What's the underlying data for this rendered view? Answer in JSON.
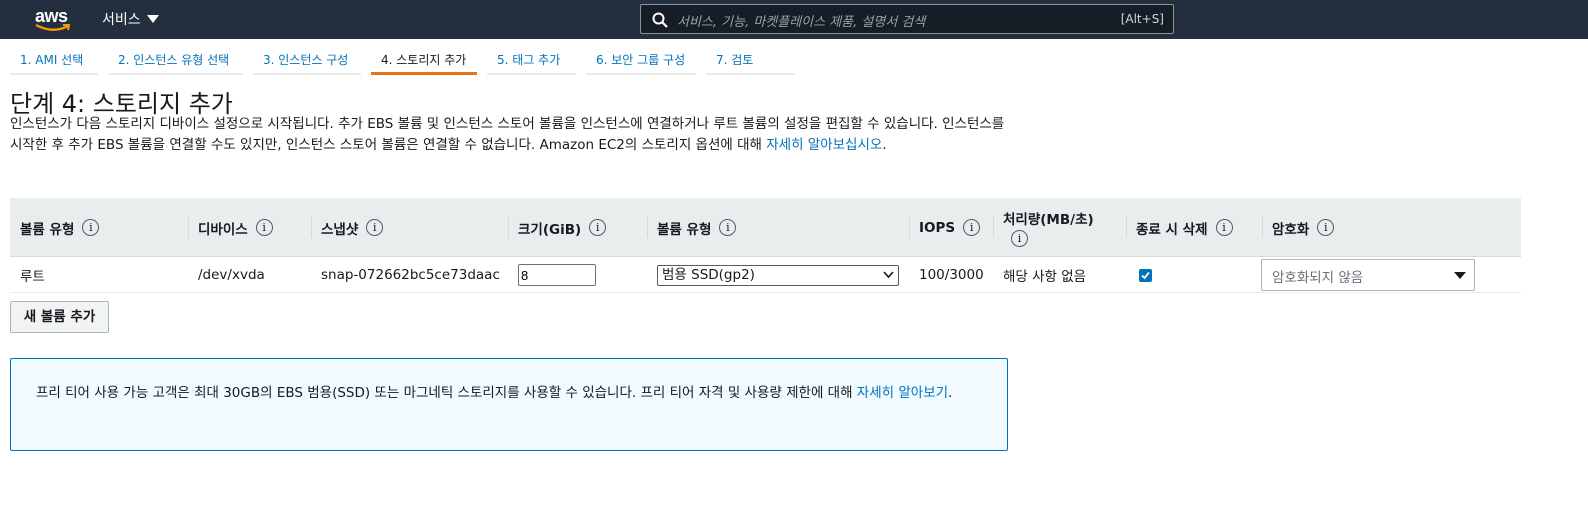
{
  "nav": {
    "logo_text": "aws",
    "services_label": "서비스",
    "search_placeholder": "서비스, 기능, 마켓플레이스 제품, 설명서 검색",
    "search_shortcut": "[Alt+S]"
  },
  "tabs": [
    {
      "label": "1. AMI 선택",
      "active": false
    },
    {
      "label": "2. 인스턴스 유형 선택",
      "active": false
    },
    {
      "label": "3. 인스턴스 구성",
      "active": false
    },
    {
      "label": "4. 스토리지 추가",
      "active": true
    },
    {
      "label": "5. 태그 추가",
      "active": false
    },
    {
      "label": "6. 보안 그룹 구성",
      "active": false
    },
    {
      "label": "7. 검토",
      "active": false
    }
  ],
  "page": {
    "title": "단계 4: 스토리지 추가",
    "description": "인스턴스가 다음 스토리지 디바이스 설정으로 시작됩니다. 추가 EBS 볼륨 및 인스턴스 스토어 볼륨을 인스턴스에 연결하거나 루트 볼륨의 설정을 편집할 수 있습니다. 인스턴스를 시작한 후 추가 EBS 볼륨을 연결할 수도 있지만, 인스턴스 스토어 볼륨은 연결할 수 없습니다. Amazon EC2의 스토리지 옵션에 대해 ",
    "learn_more": "자세히 알아보십시오",
    "period": "."
  },
  "table": {
    "headers": {
      "volume_type": "볼륨 유형",
      "device": "디바이스",
      "snapshot": "스냅샷",
      "size": "크기(GiB)",
      "ebs_type": "볼륨 유형",
      "iops": "IOPS",
      "throughput": "처리량(MB/초)",
      "delete_on_term": "종료 시 삭제",
      "encryption": "암호화"
    },
    "info_glyph": "i",
    "row": {
      "volume_type": "루트",
      "device": "/dev/xvda",
      "snapshot": "snap-072662bc5ce73daac",
      "size": "8",
      "ebs_type": "범용 SSD(gp2)",
      "iops": "100/3000",
      "throughput": "해당 사항 없음",
      "delete_on_termination": true,
      "encryption": "암호화되지 않음"
    }
  },
  "add_volume_label": "새 볼륨 추가",
  "alert": {
    "text": "프리 티어 사용 가능 고객은 최대 30GB의 EBS 범용(SSD) 또는 마그네틱 스토리지를 사용할 수 있습니다. 프리 티어 자격 및 사용량 제한에 대해 ",
    "link": "자세히 알아보기",
    "period": "."
  },
  "colors": {
    "nav_bg": "#232f3e",
    "accent": "#ec7211",
    "link": "#0073bb",
    "alert_bg": "#f1faff"
  }
}
